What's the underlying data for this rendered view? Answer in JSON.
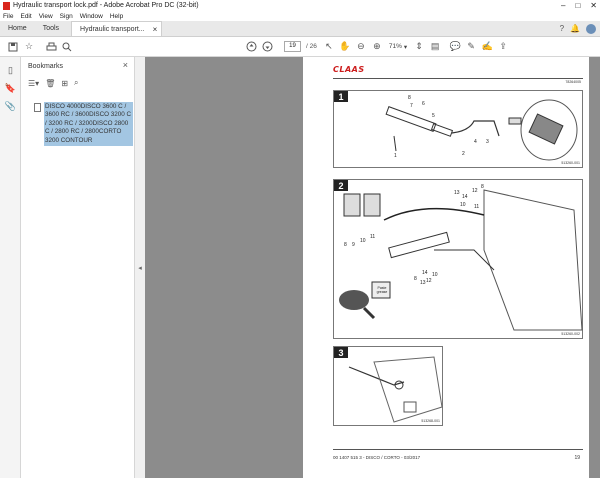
{
  "window": {
    "title": "Hydraulic transport lock.pdf - Adobe Acrobat Pro DC (32-bit)"
  },
  "menu": [
    "File",
    "Edit",
    "View",
    "Sign",
    "Window",
    "Help"
  ],
  "tabs": {
    "home": "Home",
    "tools": "Tools",
    "document": "Hydraulic transport..."
  },
  "toolbar": {
    "page_current": "19",
    "page_total": "/ 26",
    "zoom": "71%"
  },
  "bookmarks": {
    "title": "Bookmarks",
    "item_label": "DISCO 4000DISCO 3600 C / 3600 RC / 3600DISCO 3200 C / 3200 RC / 3200DISCO 2800 C / 2800 RC / 2800CORTO 3200 CONTOUR"
  },
  "document": {
    "brand": "CLAAS",
    "header_code": "78264005",
    "figures": [
      {
        "number": "1",
        "code": "513260-001"
      },
      {
        "number": "2",
        "code": "513260-002"
      },
      {
        "number": "3",
        "code": "513268-001"
      }
    ],
    "fig1_labels": [
      "8",
      "7",
      "6",
      "5",
      "4",
      "3",
      "2",
      "1"
    ],
    "fig2_labels_top": [
      "8",
      "12",
      "13",
      "14",
      "10",
      "11"
    ],
    "fig2_labels_left": [
      "9",
      "10",
      "11",
      "8"
    ],
    "fig2_labels_bottom": [
      "8",
      "13",
      "12",
      "14",
      "10"
    ],
    "fig2_grease_label": "Paste grease",
    "footer": "00 1407 515 3 - DISCO / CORTO - 03/2017",
    "page_number": "19"
  },
  "colors": {
    "accent_red": "#cc1b1b",
    "bookmark_highlight": "#a3c6e2",
    "viewer_bg": "#8c8c8c"
  }
}
